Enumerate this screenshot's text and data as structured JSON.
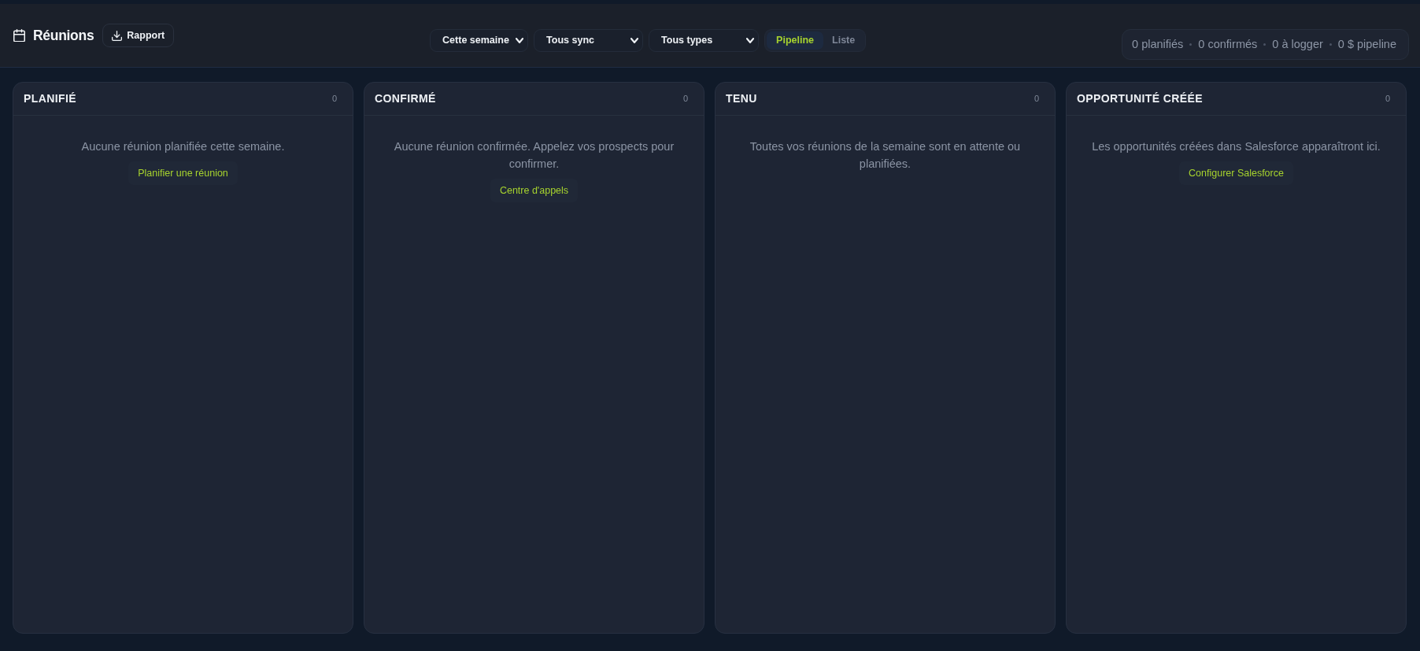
{
  "header": {
    "title": "Réunions",
    "report_button": "Rapport"
  },
  "filters": [
    "Cette semaine",
    "Tous sync",
    "Tous types"
  ],
  "view_toggle": [
    {
      "label": "Pipeline",
      "selected": true
    },
    {
      "label": "Liste",
      "selected": false
    }
  ],
  "summary": [
    "0 planifiés",
    "0 confirmés",
    "0 à logger",
    "0 $ pipeline"
  ],
  "columns": [
    {
      "title": "PLANIFIÉ",
      "count": "0",
      "empty_message": "Aucune réunion planifiée cette semaine.",
      "action": "Planifier une réunion"
    },
    {
      "title": "CONFIRMÉ",
      "count": "0",
      "empty_message": "Aucune réunion confirmée. Appelez vos prospects pour confirmer.",
      "action": "Centre d'appels"
    },
    {
      "title": "TENU",
      "count": "0",
      "empty_message": "Toutes vos réunions de la semaine sont en attente ou planifiées."
    },
    {
      "title": "OPPORTUNITÉ CRÉÉE",
      "count": "0",
      "empty_message": "Les opportunités créées dans Salesforce apparaîtront ici.",
      "action": "Configurer Salesforce"
    }
  ]
}
